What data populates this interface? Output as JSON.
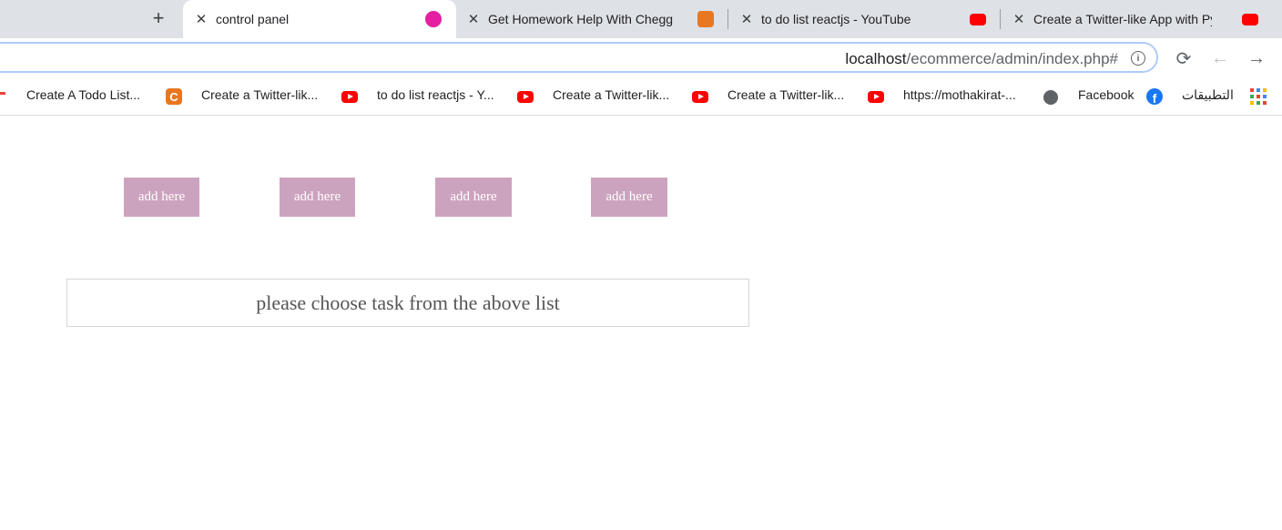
{
  "browser": {
    "tabs": [
      {
        "title": "control panel",
        "active": true,
        "favicon": "wamp-icon"
      },
      {
        "title": "Get Homework Help With Chegg",
        "active": false,
        "favicon": "chegg-icon"
      },
      {
        "title": "to do list reactjs - YouTube",
        "active": false,
        "favicon": "youtube-icon"
      },
      {
        "title": "Create a Twitter-like App with Pyt",
        "active": false,
        "favicon": "youtube-icon"
      }
    ],
    "address": {
      "host": "localhost",
      "path": "/ecommerce/admin/index.php#"
    },
    "bookmarks": [
      {
        "label": "Create A Todo List...",
        "icon": "chegg-icon"
      },
      {
        "label": "Create a Twitter-lik...",
        "icon": "youtube-icon"
      },
      {
        "label": "to do list reactjs - Y...",
        "icon": "youtube-icon"
      },
      {
        "label": "Create a Twitter-lik...",
        "icon": "youtube-icon"
      },
      {
        "label": "Create a Twitter-lik...",
        "icon": "youtube-icon"
      },
      {
        "label": "https://mothakirat-...",
        "icon": "globe-icon"
      },
      {
        "label": "Facebook",
        "icon": "facebook-icon"
      },
      {
        "label": "التطبيقات",
        "icon": "apps-grid-icon"
      }
    ]
  },
  "page": {
    "buttons": [
      "add here",
      "add here",
      "add here",
      "add here"
    ],
    "notice": "please choose task from the above list"
  },
  "colors": {
    "button_bg": "#cca3be",
    "button_text": "#ffffff",
    "notice_text": "#555555",
    "tabstrip_bg": "#dee1e6"
  }
}
